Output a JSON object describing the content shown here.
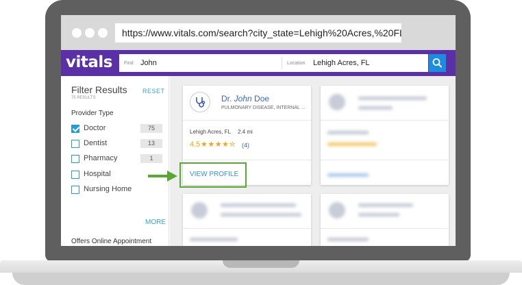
{
  "browser": {
    "url": "https://www.vitals.com/search?city_state=Lehigh%20Acres,%20FL&la"
  },
  "header": {
    "logo": "vitals",
    "find_label": "Find",
    "find_value": "John",
    "location_label": "Location",
    "location_value": "Lehigh Acres, FL",
    "search_icon": "search-icon",
    "brand_color": "#5b2fa6",
    "button_color": "#1b8de0"
  },
  "filters": {
    "title": "Filter Results",
    "reset": "RESET",
    "results_count": "75 RESULTS",
    "provider_type_heading": "Provider Type",
    "items": [
      {
        "label": "Doctor",
        "count": "75",
        "checked": true
      },
      {
        "label": "Dentist",
        "count": "13",
        "checked": false
      },
      {
        "label": "Pharmacy",
        "count": "1",
        "checked": false
      },
      {
        "label": "Hospital",
        "count": "",
        "checked": false
      },
      {
        "label": "Nursing Home",
        "count": "",
        "checked": false
      }
    ],
    "more": "MORE",
    "online_heading": "Offers Online Appointment"
  },
  "result": {
    "name_prefix": "Dr. ",
    "name_first": "John",
    "name_last": " Doe",
    "specialty": "PULMONARY DISEASE, INTERNAL ...",
    "location": "Lehigh Acres, FL",
    "distance": "2.4 mi",
    "rating": "4.5",
    "stars": "★★★★✮",
    "reviews": "(4)",
    "view_profile": "VIEW PROFILE",
    "icon": "stethoscope-icon"
  },
  "annotation": {
    "highlight_color": "#5aa834"
  }
}
